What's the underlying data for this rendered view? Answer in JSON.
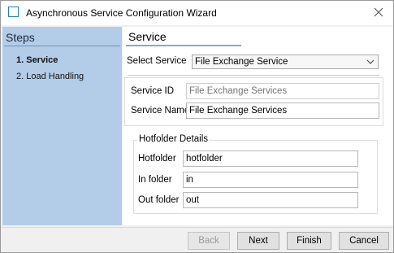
{
  "window": {
    "title": "Asynchronous Service Configuration Wizard",
    "close_icon": "close-icon"
  },
  "steps": {
    "title": "Steps",
    "items": [
      {
        "label": "1. Service",
        "active": true
      },
      {
        "label": "2. Load Handling",
        "active": false
      }
    ]
  },
  "service": {
    "title": "Service",
    "select_label": "Select Service",
    "select_value": "File Exchange Service",
    "service_id_label": "Service ID",
    "service_id_placeholder": "File Exchange Services",
    "service_name_label": "Service Name",
    "service_name_value": "File Exchange Services"
  },
  "hotfolder": {
    "title": "Hotfolder Details",
    "hotfolder_label": "Hotfolder",
    "hotfolder_value": "hotfolder",
    "in_label": "In folder",
    "in_value": "in",
    "out_label": "Out folder",
    "out_value": "out"
  },
  "buttons": {
    "back": "Back",
    "next": "Next",
    "finish": "Finish",
    "cancel": "Cancel"
  },
  "colors": {
    "steps_panel": "#b3cde8",
    "window_bg": "#f0f0f0",
    "accent": "#1f7bd0"
  }
}
